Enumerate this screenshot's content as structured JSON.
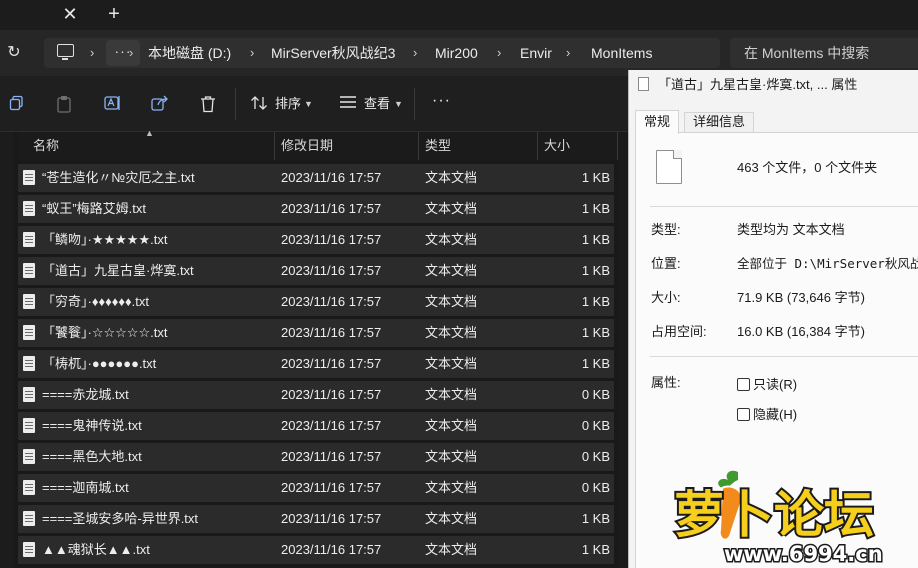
{
  "tabbar": {
    "close_glyph": "✕",
    "new_tab_glyph": "+"
  },
  "address": {
    "refresh_glyph": "↻",
    "more_glyph": "···",
    "chevron": "›",
    "crumbs": [
      "本地磁盘 (D:)",
      "MirServer秋风战纪3",
      "Mir200",
      "Envir",
      "MonItems"
    ],
    "search_placeholder": "在 MonItems 中搜索"
  },
  "toolbar": {
    "sort_label": "排序",
    "view_label": "查看",
    "more_glyph": "···",
    "icons": [
      "copy-icon",
      "paste-icon",
      "rename-icon",
      "share-icon",
      "delete-icon",
      "sort-icon",
      "view-icon"
    ]
  },
  "columns": {
    "name": "名称",
    "date": "修改日期",
    "type": "类型",
    "size": "大小"
  },
  "files": [
    {
      "name": "“苍生造化〃№灾厄之主.txt",
      "date": "2023/11/16 17:57",
      "type": "文本文档",
      "size": "1 KB"
    },
    {
      "name": "“蚁王”梅路艾姆.txt",
      "date": "2023/11/16 17:57",
      "type": "文本文档",
      "size": "1 KB"
    },
    {
      "name": "「鳞吻」·★★★★★.txt",
      "date": "2023/11/16 17:57",
      "type": "文本文档",
      "size": "1 KB"
    },
    {
      "name": "「道古」九星古皇·烨寞.txt",
      "date": "2023/11/16 17:57",
      "type": "文本文档",
      "size": "1 KB"
    },
    {
      "name": "「穷奇」·♦♦♦♦♦♦.txt",
      "date": "2023/11/16 17:57",
      "type": "文本文档",
      "size": "1 KB"
    },
    {
      "name": "「饕餮」·☆☆☆☆☆.txt",
      "date": "2023/11/16 17:57",
      "type": "文本文档",
      "size": "1 KB"
    },
    {
      "name": "「梼杌」·●●●●●●.txt",
      "date": "2023/11/16 17:57",
      "type": "文本文档",
      "size": "1 KB"
    },
    {
      "name": "====赤龙城.txt",
      "date": "2023/11/16 17:57",
      "type": "文本文档",
      "size": "0 KB"
    },
    {
      "name": "====鬼神传说.txt",
      "date": "2023/11/16 17:57",
      "type": "文本文档",
      "size": "0 KB"
    },
    {
      "name": "====黑色大地.txt",
      "date": "2023/11/16 17:57",
      "type": "文本文档",
      "size": "0 KB"
    },
    {
      "name": "====迦南城.txt",
      "date": "2023/11/16 17:57",
      "type": "文本文档",
      "size": "0 KB"
    },
    {
      "name": "====圣城安多哈-异世界.txt",
      "date": "2023/11/16 17:57",
      "type": "文本文档",
      "size": "1 KB"
    },
    {
      "name": "▲▲魂狱长▲▲.txt",
      "date": "2023/11/16 17:57",
      "type": "文本文档",
      "size": "1 KB"
    }
  ],
  "dialog": {
    "title": "「道古」九星古皇·烨寞.txt, ... 属性",
    "tabs": [
      "常规",
      "详细信息"
    ],
    "summary": "463 个文件，0 个文件夹",
    "rows": [
      {
        "label": "类型:",
        "value": "类型均为 文本文档"
      },
      {
        "label": "位置:",
        "value": "全部位于 D:\\MirServer秋风战纪3"
      },
      {
        "label": "大小:",
        "value": "71.9 KB (73,646 字节)"
      },
      {
        "label": "占用空间:",
        "value": "16.0 KB (16,384 字节)"
      }
    ],
    "attributes_label": "属性:",
    "readonly_label": "只读(R)",
    "hidden_label": "隐藏(H)"
  },
  "watermark": {
    "text": "萝卜论坛",
    "url": "www.6994.cn"
  }
}
